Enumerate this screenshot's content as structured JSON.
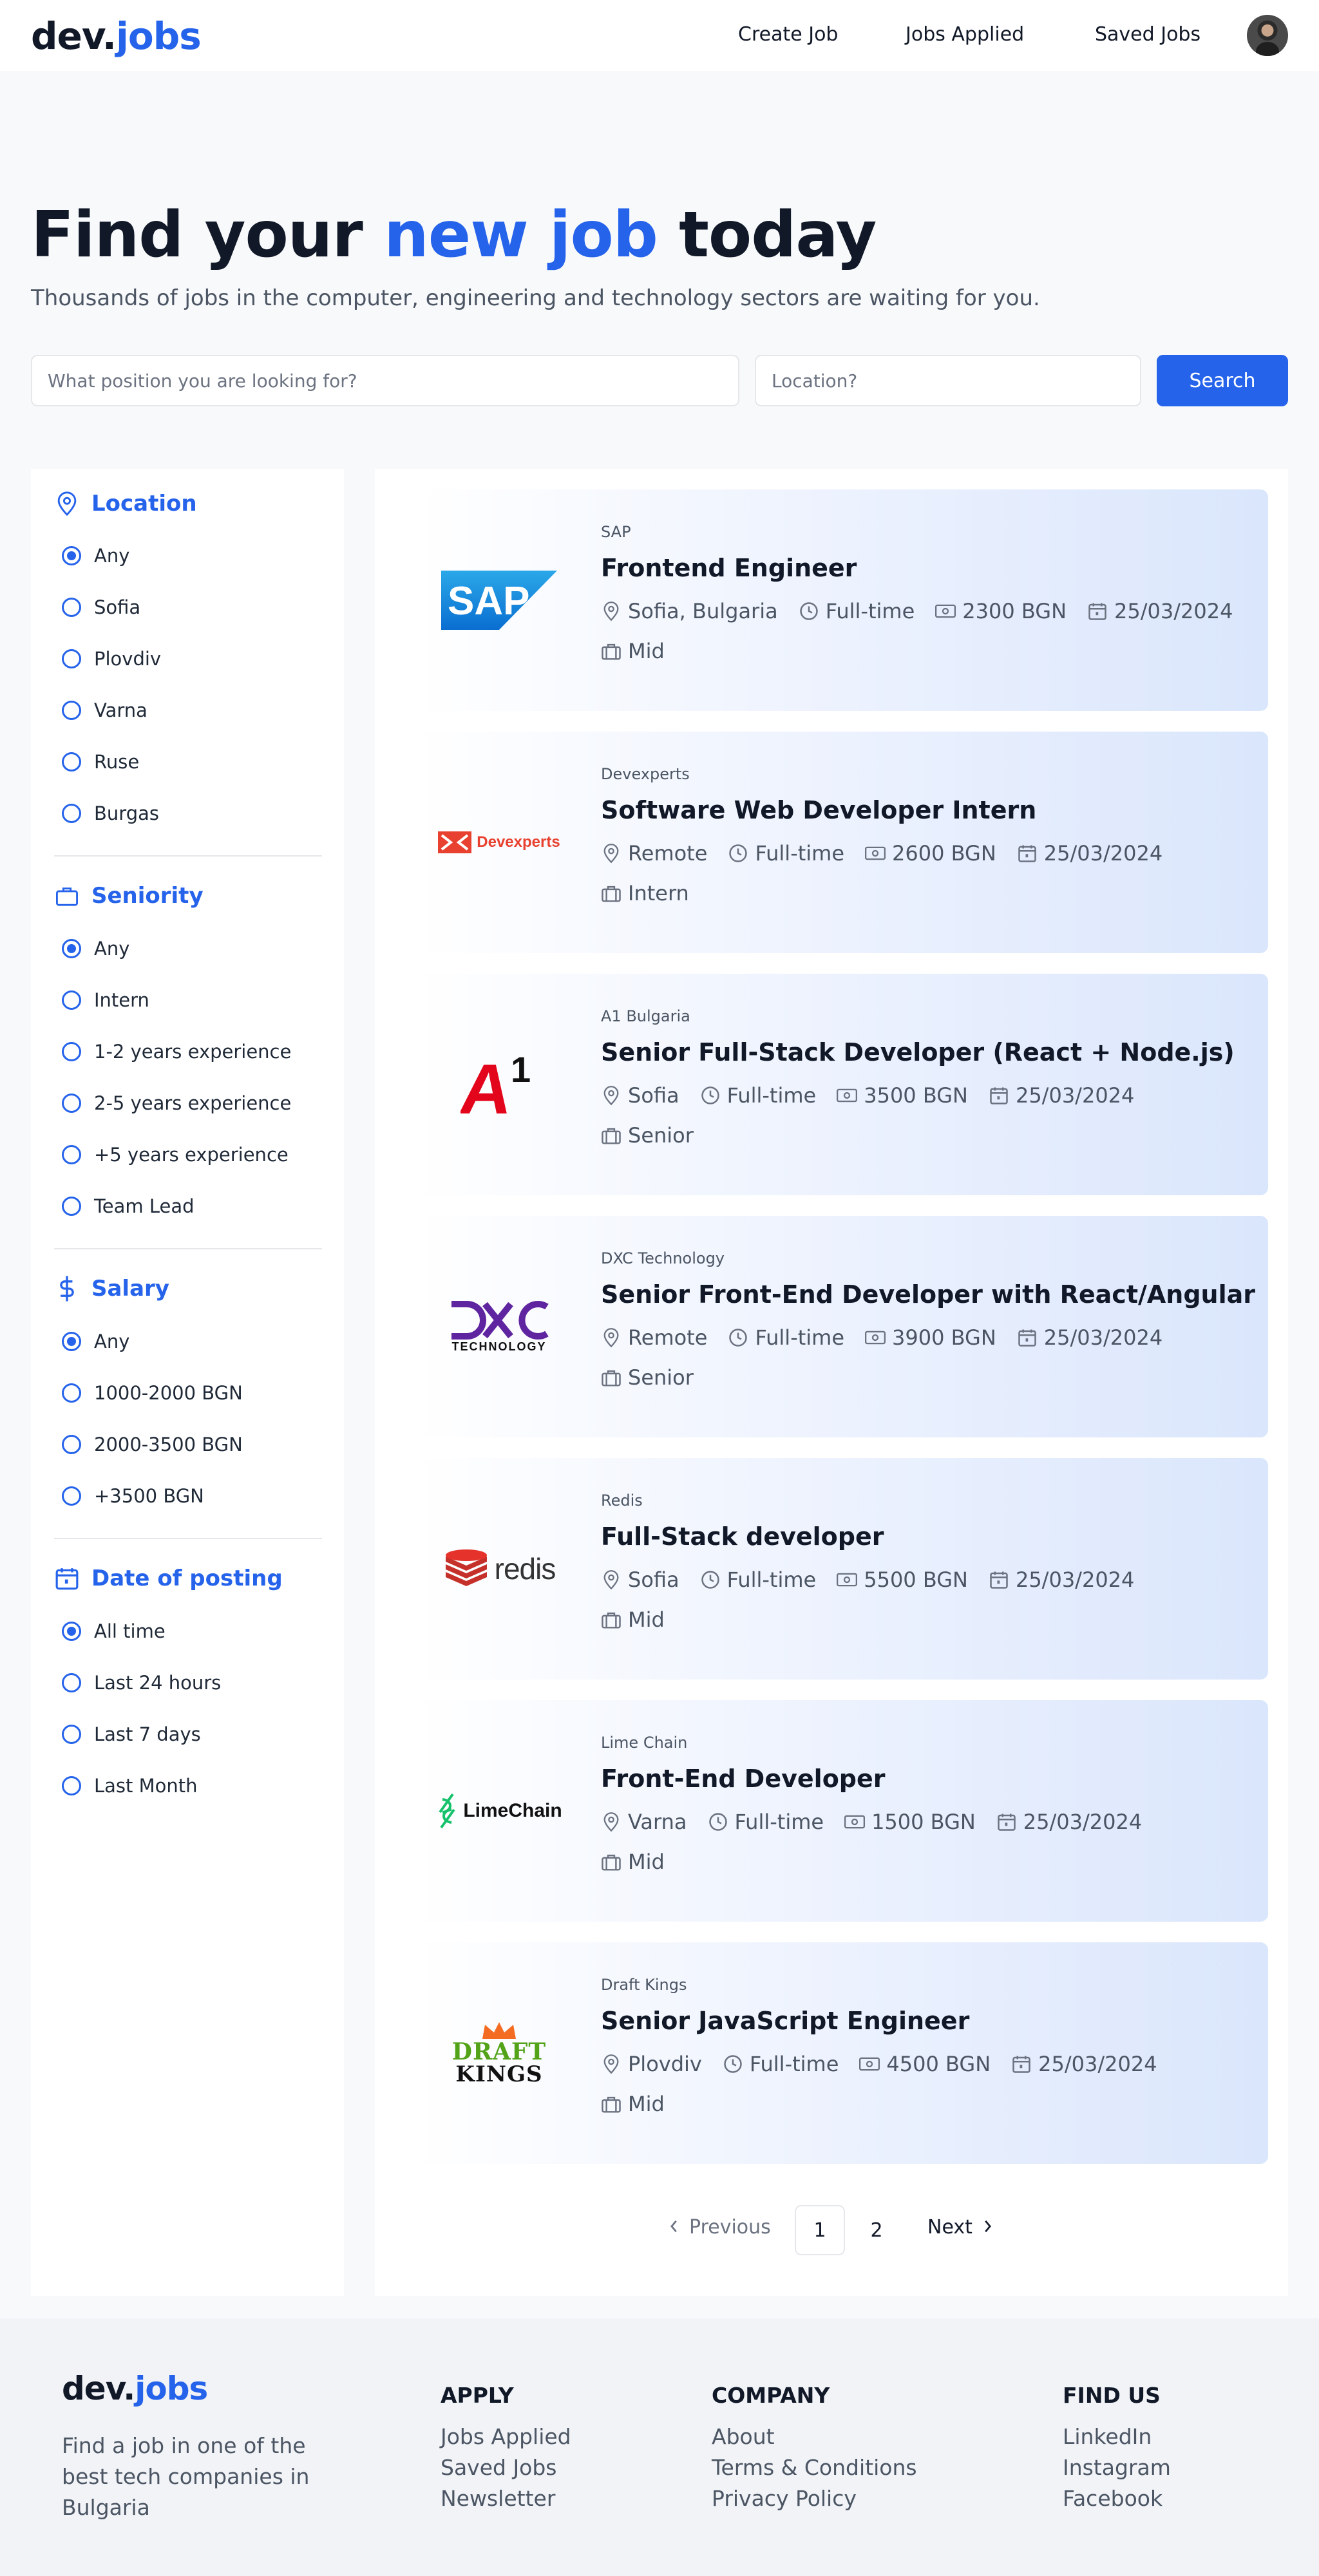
{
  "header": {
    "logo_dev": "dev.",
    "logo_jobs": "jobs",
    "nav": [
      "Create Job",
      "Jobs Applied",
      "Saved Jobs"
    ]
  },
  "hero": {
    "title_start": "Find your ",
    "title_accent": "new job",
    "title_end": " today",
    "subtitle": "Thousands of jobs in the computer, engineering and technology sectors are waiting for you."
  },
  "search": {
    "position_placeholder": "What position you are looking for?",
    "position_value": "",
    "location_placeholder": "Location?",
    "location_value": "",
    "button": "Search"
  },
  "filters": {
    "location": {
      "title": "Location",
      "icon": "map-pin-icon",
      "options": [
        "Any",
        "Sofia",
        "Plovdiv",
        "Varna",
        "Ruse",
        "Burgas"
      ],
      "selected": "Any"
    },
    "seniority": {
      "title": "Seniority",
      "icon": "briefcase-icon",
      "options": [
        "Any",
        "Intern",
        "1-2 years experience",
        "2-5 years experience",
        "+5 years experience",
        "Team Lead"
      ],
      "selected": "Any"
    },
    "salary": {
      "title": "Salary",
      "icon": "dollar-icon",
      "options": [
        "Any",
        "1000-2000 BGN",
        "2000-3500 BGN",
        "+3500 BGN"
      ],
      "selected": "Any"
    },
    "date": {
      "title": "Date of posting",
      "icon": "calendar-icon",
      "options": [
        "All time",
        "Last 24 hours",
        "Last 7 days",
        "Last Month"
      ],
      "selected": "All time"
    }
  },
  "jobs": [
    {
      "company": "SAP",
      "title": "Frontend Engineer",
      "location": "Sofia, Bulgaria",
      "type": "Full-time",
      "salary": "2300 BGN",
      "date": "25/03/2024",
      "level": "Mid",
      "logo": "sap-logo"
    },
    {
      "company": "Devexperts",
      "title": "Software Web Developer Intern",
      "location": "Remote",
      "type": "Full-time",
      "salary": "2600 BGN",
      "date": "25/03/2024",
      "level": "Intern",
      "logo": "devexperts-logo",
      "logo_text": "Devexperts"
    },
    {
      "company": "A1 Bulgaria",
      "title": "Senior Full-Stack Developer (React + Node.js)",
      "location": "Sofia",
      "type": "Full-time",
      "salary": "3500 BGN",
      "date": "25/03/2024",
      "level": "Senior",
      "logo": "a1-logo"
    },
    {
      "company": "DXC Technology",
      "title": "Senior Front-End Developer with React/Angular",
      "location": "Remote",
      "type": "Full-time",
      "salary": "3900 BGN",
      "date": "25/03/2024",
      "level": "Senior",
      "logo": "dxc-logo",
      "logo_text": "TECHNOLOGY"
    },
    {
      "company": "Redis",
      "title": "Full-Stack developer",
      "location": "Sofia",
      "type": "Full-time",
      "salary": "5500 BGN",
      "date": "25/03/2024",
      "level": "Mid",
      "logo": "redis-logo",
      "logo_text": "redis"
    },
    {
      "company": "Lime Chain",
      "title": "Front-End Developer",
      "location": "Varna",
      "type": "Full-time",
      "salary": "1500 BGN",
      "date": "25/03/2024",
      "level": "Mid",
      "logo": "limechain-logo",
      "logo_text": "LimeChain"
    },
    {
      "company": "Draft Kings",
      "title": "Senior JavaScript Engineer",
      "location": "Plovdiv",
      "type": "Full-time",
      "salary": "4500 BGN",
      "date": "25/03/2024",
      "level": "Mid",
      "logo": "draftkings-logo",
      "logo_text_1": "DRAFT",
      "logo_text_2": "KINGS"
    }
  ],
  "pagination": {
    "previous": "Previous",
    "pages": [
      "1",
      "2"
    ],
    "current": "1",
    "next": "Next"
  },
  "footer": {
    "logo_dev": "dev.",
    "logo_jobs": "jobs",
    "tagline": "Find a job in one of the best tech companies in Bulgaria",
    "columns": [
      {
        "title": "APPLY",
        "links": [
          "Jobs Applied",
          "Saved Jobs",
          "Newsletter"
        ]
      },
      {
        "title": "COMPANY",
        "links": [
          "About",
          "Terms & Conditions",
          "Privacy Policy"
        ]
      },
      {
        "title": "FIND US",
        "links": [
          "LinkedIn",
          "Instagram",
          "Facebook"
        ]
      }
    ]
  },
  "colors": {
    "accent": "#2563eb",
    "text": "#111827",
    "muted": "#4b5563",
    "card_gradient_end": "#dae6fc"
  }
}
